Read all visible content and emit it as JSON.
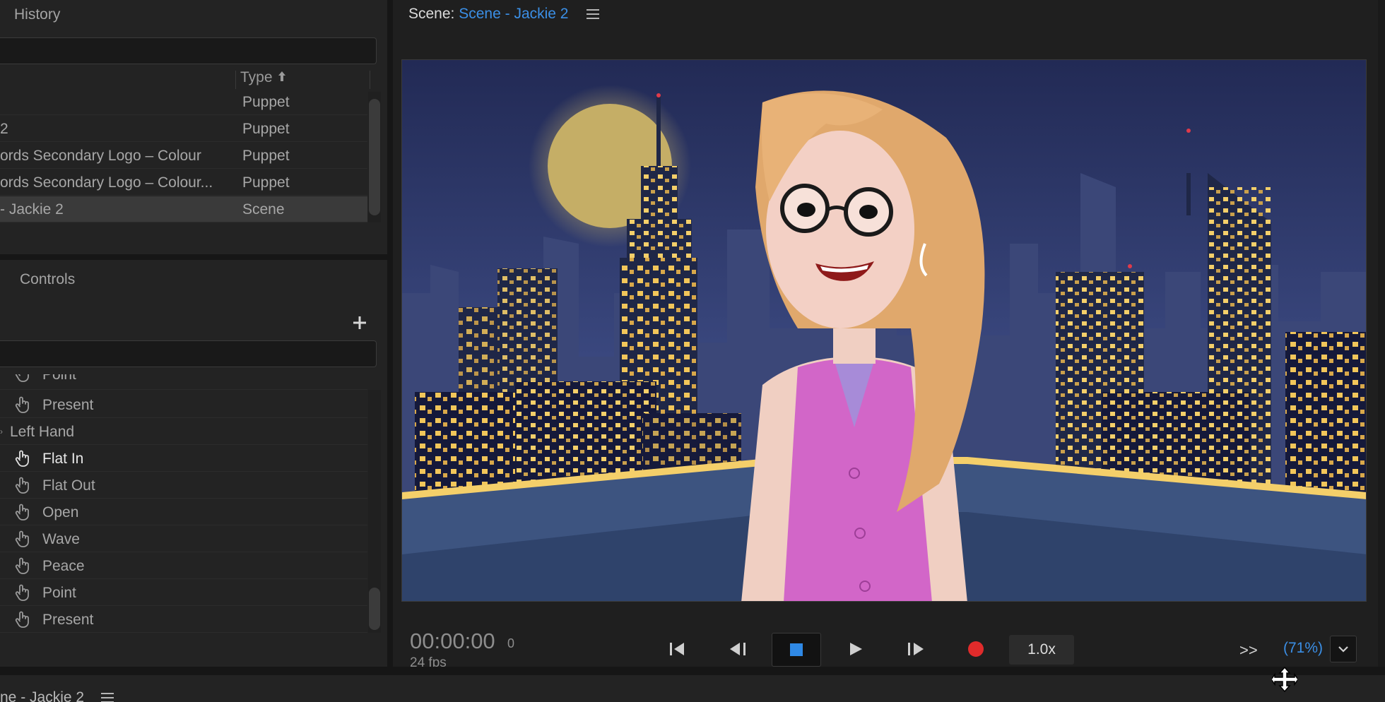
{
  "history_panel": {
    "title": "History",
    "type_column": "Type",
    "rows": [
      {
        "name": "",
        "type": "Puppet",
        "selected": false
      },
      {
        "name": "2",
        "type": "Puppet",
        "selected": false
      },
      {
        "name": "ords Secondary Logo – Colour",
        "type": "Puppet",
        "selected": false
      },
      {
        "name": "ords Secondary Logo – Colour...",
        "type": "Puppet",
        "selected": false
      },
      {
        "name": "- Jackie 2",
        "type": "Scene",
        "selected": true
      }
    ]
  },
  "controls_panel": {
    "title": "Controls",
    "add_icon": "plus-icon",
    "items": [
      {
        "label": "Present",
        "kind": "trigger",
        "icon": "hand-pointer-icon"
      },
      {
        "label": "Left Hand",
        "kind": "group"
      },
      {
        "label": "Flat In",
        "kind": "trigger",
        "icon": "hand-pointer-icon",
        "active": true
      },
      {
        "label": "Flat Out",
        "kind": "trigger",
        "icon": "hand-pointer-icon"
      },
      {
        "label": "Open",
        "kind": "trigger",
        "icon": "hand-pointer-icon"
      },
      {
        "label": "Wave",
        "kind": "trigger",
        "icon": "hand-pointer-icon"
      },
      {
        "label": "Peace",
        "kind": "trigger",
        "icon": "hand-pointer-icon"
      },
      {
        "label": "Point",
        "kind": "trigger",
        "icon": "hand-pointer-icon"
      },
      {
        "label": "Present",
        "kind": "trigger",
        "icon": "hand-pointer-icon"
      }
    ]
  },
  "scene": {
    "prefix": "Scene:",
    "name": "Scene - Jackie 2",
    "menu_icon": "hamburger-icon"
  },
  "transport": {
    "timecode": "00:00:00",
    "frame": "0",
    "fps": "24 fps",
    "speed": "1.0x",
    "zoom": "(71%)",
    "more": ">>",
    "icons": [
      "skip-to-start-icon",
      "step-back-icon",
      "stop-icon",
      "play-icon",
      "step-forward-icon",
      "record-icon",
      "chevron-down-icon"
    ]
  },
  "bottom_tab": {
    "label": "ne - Jackie 2"
  },
  "colors": {
    "accent_blue": "#3b8fe6",
    "record_red": "#e02b2b"
  }
}
